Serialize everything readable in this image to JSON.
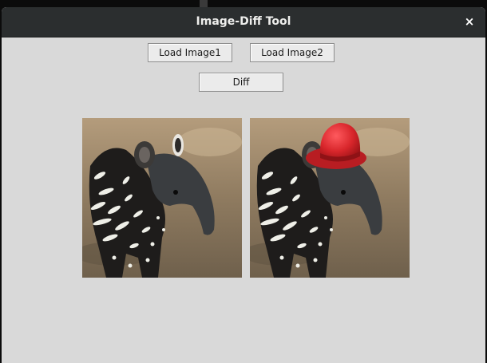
{
  "window": {
    "title": "Image-Diff Tool",
    "close_glyph": "×",
    "close_icon": "close-icon"
  },
  "toolbar": {
    "load_image1_label": "Load Image1",
    "load_image2_label": "Load Image2",
    "diff_label": "Diff"
  },
  "images": [
    {
      "subject": "tapir-calf",
      "overlay": "none"
    },
    {
      "subject": "tapir-calf",
      "overlay": "red-bowler-hat"
    }
  ],
  "colors": {
    "titlebar": "#2b2e2f",
    "window_bg": "#d9d9d9",
    "button_bg": "#ebebeb",
    "hat_red": "#d8262b"
  }
}
